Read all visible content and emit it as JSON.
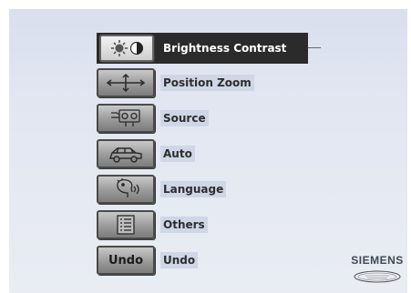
{
  "menu": {
    "items": [
      {
        "label": "Brightness Contrast",
        "icon": "brightness-contrast-icon",
        "selected": true
      },
      {
        "label": "Position Zoom",
        "icon": "position-zoom-icon",
        "selected": false
      },
      {
        "label": "Source",
        "icon": "source-icon",
        "selected": false
      },
      {
        "label": "Auto",
        "icon": "auto-icon",
        "selected": false
      },
      {
        "label": "Language",
        "icon": "language-icon",
        "selected": false
      },
      {
        "label": "Others",
        "icon": "others-icon",
        "selected": false
      },
      {
        "label": "Undo",
        "icon": "undo-icon",
        "icon_text": "Undo",
        "selected": false
      }
    ]
  },
  "brand": {
    "name": "SIEMENS"
  },
  "colors": {
    "selected_bg": "#2b2b2b",
    "screen_bg": "#e1e6f1",
    "label_bg": "#cfd6e6"
  }
}
